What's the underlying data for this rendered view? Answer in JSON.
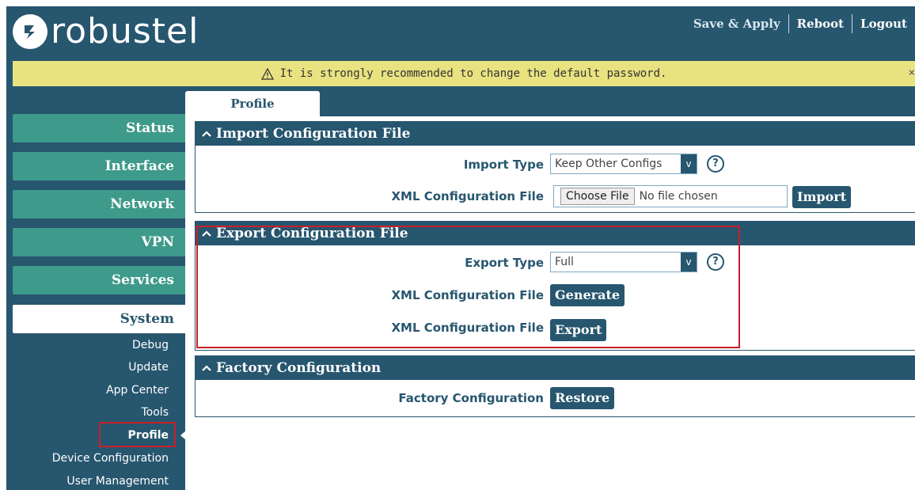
{
  "header": {
    "brand": "robustel",
    "actions": [
      "Save & Apply",
      "Reboot",
      "Logout"
    ]
  },
  "warning": {
    "text": "It is strongly recommended to change the default password.",
    "close": "×"
  },
  "sidebar": {
    "menus": [
      "Status",
      "Interface",
      "Network",
      "VPN",
      "Services",
      "System"
    ],
    "active_menu": "System",
    "submenu": [
      "Debug",
      "Update",
      "App Center",
      "Tools",
      "Profile",
      "Device Configuration",
      "User Management"
    ],
    "active_submenu": "Profile"
  },
  "tab": {
    "label": "Profile"
  },
  "import": {
    "title": "Import Configuration File",
    "type_label": "Import Type",
    "type_value": "Keep Other Configs",
    "file_label": "XML Configuration File",
    "choose_file": "Choose File",
    "file_status": "No file chosen",
    "import_button": "Import"
  },
  "export": {
    "title": "Export Configuration File",
    "type_label": "Export Type",
    "type_value": "Full",
    "generate_label": "XML Configuration File",
    "generate_button": "Generate",
    "export_label": "XML Configuration File",
    "export_button": "Export"
  },
  "factory": {
    "title": "Factory Configuration",
    "label": "Factory Configuration",
    "restore_button": "Restore"
  },
  "icons": {
    "select_arrow": "v",
    "help": "?"
  },
  "colors": {
    "primary": "#27566f",
    "menu": "#3e9a8a",
    "warning_bg": "#e8e280",
    "highlight": "#c8202a"
  }
}
